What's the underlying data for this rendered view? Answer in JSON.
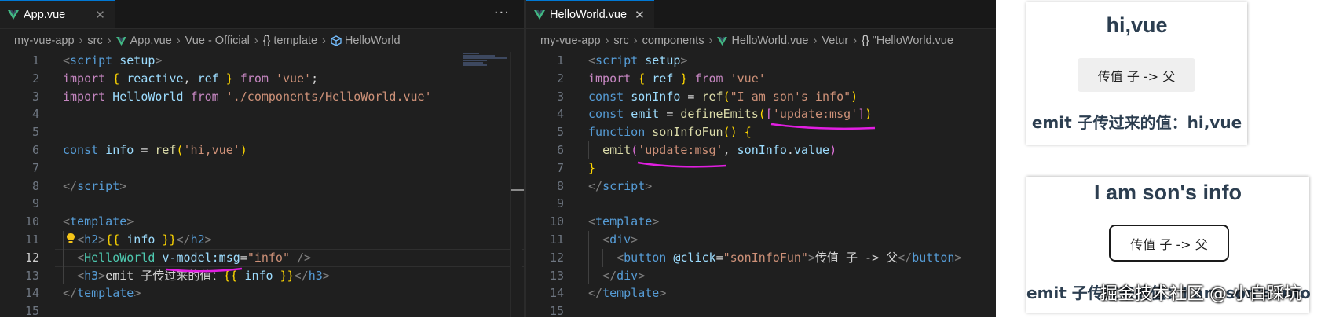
{
  "left_editor": {
    "tab": {
      "label": "App.vue",
      "close": "✕"
    },
    "more": "···",
    "breadcrumb": [
      "my-vue-app",
      "src",
      "App.vue",
      "Vue - Official",
      "template",
      "HelloWorld"
    ],
    "lines": [
      {
        "n": "1",
        "tokens": [
          [
            "t-punc",
            "<"
          ],
          [
            "t-tag",
            "script"
          ],
          [
            "t-txt",
            " "
          ],
          [
            "t-attr",
            "setup"
          ],
          [
            "t-punc",
            ">"
          ]
        ]
      },
      {
        "n": "2",
        "tokens": [
          [
            "t-kw",
            "import"
          ],
          [
            "t-txt",
            " "
          ],
          [
            "t-brace",
            "{"
          ],
          [
            "t-txt",
            " "
          ],
          [
            "t-var",
            "reactive"
          ],
          [
            "t-txt",
            ", "
          ],
          [
            "t-var",
            "ref"
          ],
          [
            "t-txt",
            " "
          ],
          [
            "t-brace",
            "}"
          ],
          [
            "t-txt",
            " "
          ],
          [
            "t-kw",
            "from"
          ],
          [
            "t-txt",
            " "
          ],
          [
            "t-str",
            "'vue'"
          ],
          [
            "t-txt",
            ";"
          ]
        ]
      },
      {
        "n": "3",
        "tokens": [
          [
            "t-kw",
            "import"
          ],
          [
            "t-txt",
            " "
          ],
          [
            "t-var",
            "HelloWorld"
          ],
          [
            "t-txt",
            " "
          ],
          [
            "t-kw",
            "from"
          ],
          [
            "t-txt",
            " "
          ],
          [
            "t-str",
            "'./components/HelloWorld.vue'"
          ]
        ]
      },
      {
        "n": "4",
        "tokens": []
      },
      {
        "n": "5",
        "tokens": []
      },
      {
        "n": "6",
        "tokens": [
          [
            "t-kw2",
            "const"
          ],
          [
            "t-txt",
            " "
          ],
          [
            "t-var",
            "info"
          ],
          [
            "t-txt",
            " = "
          ],
          [
            "t-fn",
            "ref"
          ],
          [
            "t-brace",
            "("
          ],
          [
            "t-str",
            "'hi,vue'"
          ],
          [
            "t-brace",
            ")"
          ]
        ]
      },
      {
        "n": "7",
        "tokens": []
      },
      {
        "n": "8",
        "tokens": [
          [
            "t-punc",
            "</"
          ],
          [
            "t-tag",
            "script"
          ],
          [
            "t-punc",
            ">"
          ]
        ]
      },
      {
        "n": "9",
        "tokens": []
      },
      {
        "n": "10",
        "tokens": [
          [
            "t-punc",
            "<"
          ],
          [
            "t-tag",
            "template"
          ],
          [
            "t-punc",
            ">"
          ]
        ]
      },
      {
        "n": "11",
        "tokens": [
          [
            "t-txt",
            "  "
          ],
          [
            "t-punc",
            "<"
          ],
          [
            "t-tag",
            "h2"
          ],
          [
            "t-punc",
            ">"
          ],
          [
            "t-brace",
            "{{"
          ],
          [
            "t-txt",
            " "
          ],
          [
            "t-var",
            "info"
          ],
          [
            "t-txt",
            " "
          ],
          [
            "t-brace",
            "}}"
          ],
          [
            "t-punc",
            "</"
          ],
          [
            "t-tag",
            "h2"
          ],
          [
            "t-punc",
            ">"
          ]
        ]
      },
      {
        "n": "12",
        "tokens": [
          [
            "t-txt",
            "  "
          ],
          [
            "t-punc",
            "<"
          ],
          [
            "t-cls",
            "HelloWorld"
          ],
          [
            "t-txt",
            " "
          ],
          [
            "t-attr",
            "v-model:msg"
          ],
          [
            "t-txt",
            "="
          ],
          [
            "t-str",
            "\"info\""
          ],
          [
            "t-txt",
            " "
          ],
          [
            "t-punc",
            "/>"
          ]
        ]
      },
      {
        "n": "13",
        "tokens": [
          [
            "t-txt",
            "  "
          ],
          [
            "t-punc",
            "<"
          ],
          [
            "t-tag",
            "h3"
          ],
          [
            "t-punc",
            ">"
          ],
          [
            "t-txt",
            "emit 子传过来的值："
          ],
          [
            "t-brace",
            "{{"
          ],
          [
            "t-txt",
            " "
          ],
          [
            "t-var",
            "info"
          ],
          [
            "t-txt",
            " "
          ],
          [
            "t-brace",
            "}}"
          ],
          [
            "t-punc",
            "</"
          ],
          [
            "t-tag",
            "h3"
          ],
          [
            "t-punc",
            ">"
          ]
        ]
      },
      {
        "n": "14",
        "tokens": [
          [
            "t-punc",
            "</"
          ],
          [
            "t-tag",
            "template"
          ],
          [
            "t-punc",
            ">"
          ]
        ]
      },
      {
        "n": "15",
        "tokens": []
      }
    ]
  },
  "right_editor": {
    "tab": {
      "label": "HelloWorld.vue",
      "close": "✕"
    },
    "breadcrumb": [
      "my-vue-app",
      "src",
      "components",
      "HelloWorld.vue",
      "Vetur",
      "\"HelloWorld.vue"
    ],
    "lines": [
      {
        "n": "1",
        "tokens": [
          [
            "t-punc",
            "<"
          ],
          [
            "t-tag",
            "script"
          ],
          [
            "t-txt",
            " "
          ],
          [
            "t-attr",
            "setup"
          ],
          [
            "t-punc",
            ">"
          ]
        ]
      },
      {
        "n": "2",
        "tokens": [
          [
            "t-kw",
            "import"
          ],
          [
            "t-txt",
            " "
          ],
          [
            "t-brace",
            "{"
          ],
          [
            "t-txt",
            " "
          ],
          [
            "t-var",
            "ref"
          ],
          [
            "t-txt",
            " "
          ],
          [
            "t-brace",
            "}"
          ],
          [
            "t-txt",
            " "
          ],
          [
            "t-kw",
            "from"
          ],
          [
            "t-txt",
            " "
          ],
          [
            "t-str",
            "'vue'"
          ]
        ]
      },
      {
        "n": "3",
        "tokens": [
          [
            "t-kw2",
            "const"
          ],
          [
            "t-txt",
            " "
          ],
          [
            "t-var",
            "sonInfo"
          ],
          [
            "t-txt",
            " = "
          ],
          [
            "t-fn",
            "ref"
          ],
          [
            "t-brace",
            "("
          ],
          [
            "t-str",
            "\"I am son's info\""
          ],
          [
            "t-brace",
            ")"
          ]
        ]
      },
      {
        "n": "4",
        "tokens": [
          [
            "t-kw2",
            "const"
          ],
          [
            "t-txt",
            " "
          ],
          [
            "t-var",
            "emit"
          ],
          [
            "t-txt",
            " = "
          ],
          [
            "t-fn",
            "defineEmits"
          ],
          [
            "t-brace",
            "("
          ],
          [
            "t-brace2",
            "["
          ],
          [
            "t-str",
            "'update:msg'"
          ],
          [
            "t-brace2",
            "]"
          ],
          [
            "t-brace",
            ")"
          ]
        ]
      },
      {
        "n": "5",
        "tokens": [
          [
            "t-kw2",
            "function"
          ],
          [
            "t-txt",
            " "
          ],
          [
            "t-fn",
            "sonInfoFun"
          ],
          [
            "t-brace",
            "()"
          ],
          [
            "t-txt",
            " "
          ],
          [
            "t-brace",
            "{"
          ]
        ]
      },
      {
        "n": "6",
        "tokens": [
          [
            "t-txt",
            "  "
          ],
          [
            "t-fn",
            "emit"
          ],
          [
            "t-brace2",
            "("
          ],
          [
            "t-str",
            "'update:msg'"
          ],
          [
            "t-txt",
            ", "
          ],
          [
            "t-var",
            "sonInfo"
          ],
          [
            "t-txt",
            "."
          ],
          [
            "t-var",
            "value"
          ],
          [
            "t-brace2",
            ")"
          ]
        ]
      },
      {
        "n": "7",
        "tokens": [
          [
            "t-brace",
            "}"
          ]
        ]
      },
      {
        "n": "8",
        "tokens": [
          [
            "t-punc",
            "</"
          ],
          [
            "t-tag",
            "script"
          ],
          [
            "t-punc",
            ">"
          ]
        ]
      },
      {
        "n": "9",
        "tokens": []
      },
      {
        "n": "10",
        "tokens": [
          [
            "t-punc",
            "<"
          ],
          [
            "t-tag",
            "template"
          ],
          [
            "t-punc",
            ">"
          ]
        ]
      },
      {
        "n": "11",
        "tokens": [
          [
            "t-txt",
            "  "
          ],
          [
            "t-punc",
            "<"
          ],
          [
            "t-tag",
            "div"
          ],
          [
            "t-punc",
            ">"
          ]
        ]
      },
      {
        "n": "12",
        "tokens": [
          [
            "t-txt",
            "    "
          ],
          [
            "t-punc",
            "<"
          ],
          [
            "t-tag",
            "button"
          ],
          [
            "t-txt",
            " "
          ],
          [
            "t-attr",
            "@click"
          ],
          [
            "t-txt",
            "="
          ],
          [
            "t-str",
            "\"sonInfoFun\""
          ],
          [
            "t-punc",
            ">"
          ],
          [
            "t-txt",
            "传值 子 -> 父"
          ],
          [
            "t-punc",
            "</"
          ],
          [
            "t-tag",
            "button"
          ],
          [
            "t-punc",
            ">"
          ]
        ]
      },
      {
        "n": "13",
        "tokens": [
          [
            "t-txt",
            "  "
          ],
          [
            "t-punc",
            "</"
          ],
          [
            "t-tag",
            "div"
          ],
          [
            "t-punc",
            ">"
          ]
        ]
      },
      {
        "n": "14",
        "tokens": [
          [
            "t-punc",
            "</"
          ],
          [
            "t-tag",
            "template"
          ],
          [
            "t-punc",
            ">"
          ]
        ]
      },
      {
        "n": "15",
        "tokens": []
      }
    ]
  },
  "preview_top": {
    "h2": "hi,vue",
    "button": "传值 子 -> 父",
    "h3": "emit 子传过来的值：hi,vue"
  },
  "preview_bottom": {
    "h2": "I am son's info",
    "button": "传值 子 -> 父",
    "h3": "emit 子传过来的值：I am son's info"
  },
  "watermark": "掘金技术社区 @ 小白踩坑",
  "colors": {
    "highlight": "#e11ee1",
    "vue_green": "#42b883",
    "bulb": "#f5c518"
  }
}
